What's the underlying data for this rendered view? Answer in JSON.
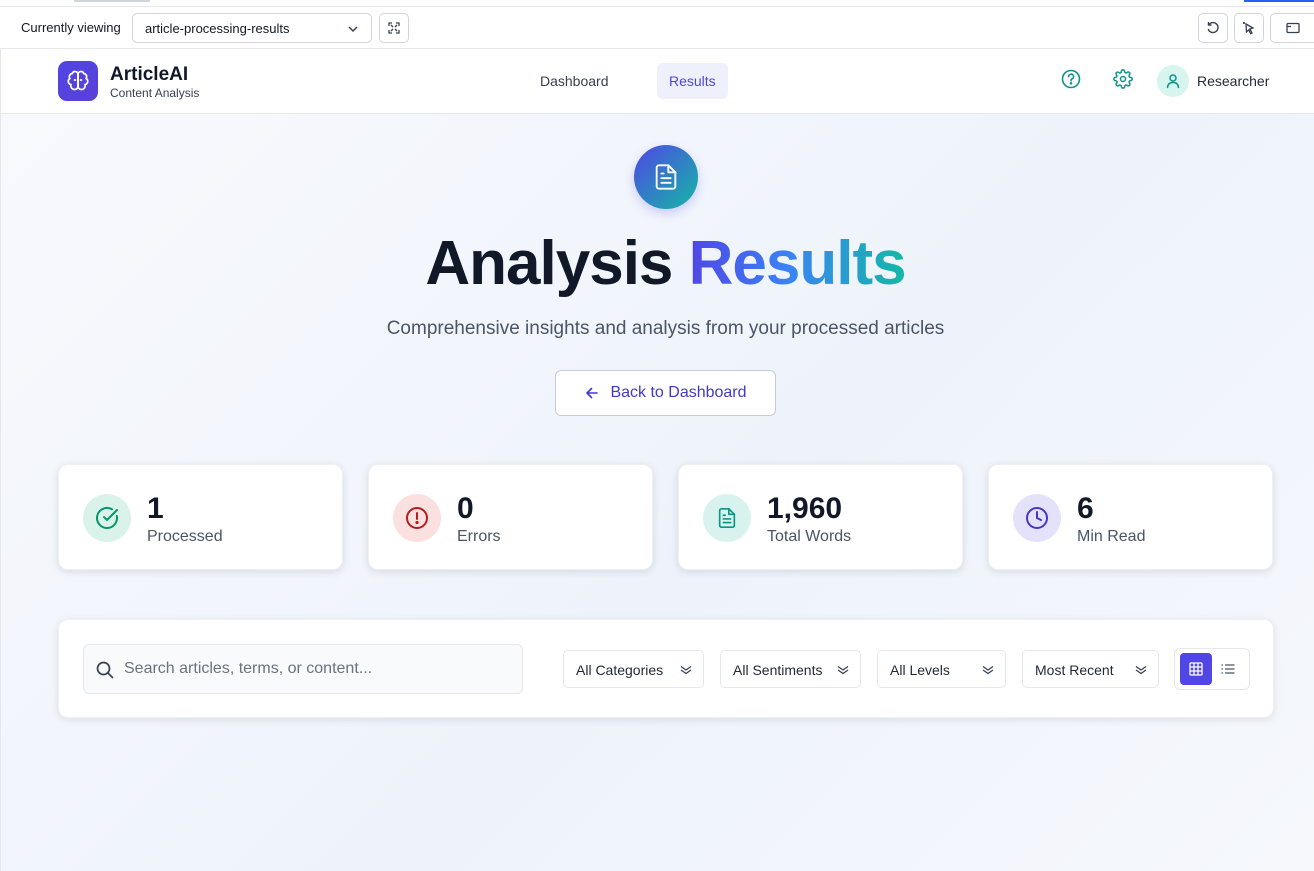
{
  "viewer": {
    "label": "Currently viewing",
    "selected_page": "article-processing-results"
  },
  "header": {
    "brand": "ArticleAI",
    "brand_sub": "Content Analysis",
    "nav": [
      {
        "label": "Dashboard",
        "active": false
      },
      {
        "label": "Results",
        "active": true
      }
    ],
    "user": "Researcher"
  },
  "hero": {
    "title_plain": "Analysis",
    "title_accent": "Results",
    "subtitle": "Comprehensive insights and analysis from your processed articles",
    "back_label": "Back to Dashboard"
  },
  "stats": [
    {
      "value": "1",
      "label": "Processed",
      "icon": "check-circle-icon",
      "color": "#059669",
      "bg": "#d9f3ea"
    },
    {
      "value": "0",
      "label": "Errors",
      "icon": "alert-circle-icon",
      "color": "#b91c1c",
      "bg": "#fbe0e0"
    },
    {
      "value": "1,960",
      "label": "Total Words",
      "icon": "document-icon",
      "color": "#0d9488",
      "bg": "#d8f3ef"
    },
    {
      "value": "6",
      "label": "Min Read",
      "icon": "clock-icon",
      "color": "#4338ca",
      "bg": "#e3e2fa"
    }
  ],
  "filters": {
    "search_placeholder": "Search articles, terms, or content...",
    "category": "All Categories",
    "sentiment": "All Sentiments",
    "level": "All Levels",
    "sort": "Most Recent"
  },
  "colors": {
    "accent": "#4f46e5",
    "teal": "#14b8a6"
  }
}
